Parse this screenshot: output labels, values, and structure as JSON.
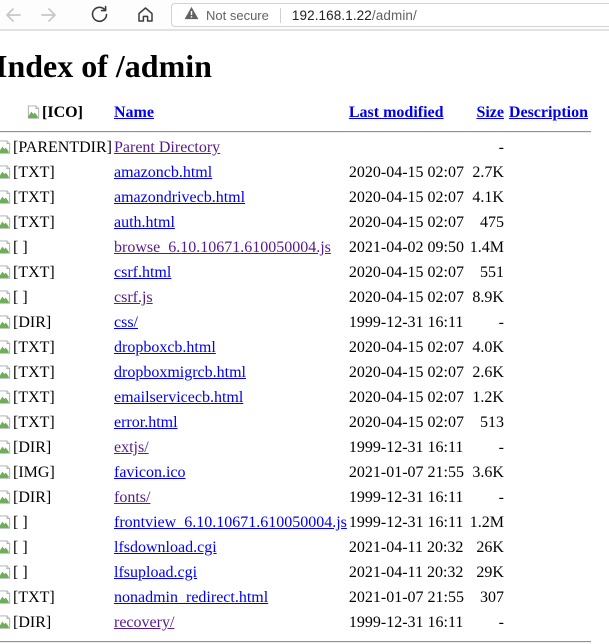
{
  "browser": {
    "security_label": "Not secure",
    "url_host": "192.168.1.22",
    "url_path": "/admin/"
  },
  "page": {
    "title": "Index of /admin",
    "columns": {
      "icon_alt": "[ICO]",
      "name": "Name",
      "last_modified": "Last modified",
      "size": "Size",
      "description": "Description"
    },
    "rows": [
      {
        "icon_alt": "[PARENTDIR]",
        "name": "Parent Directory",
        "last_modified": "",
        "size": "-",
        "description": "",
        "visited": true
      },
      {
        "icon_alt": "[TXT]",
        "name": "amazoncb.html",
        "last_modified": "2020-04-15 02:07",
        "size": "2.7K",
        "description": "",
        "visited": false
      },
      {
        "icon_alt": "[TXT]",
        "name": "amazondrivecb.html",
        "last_modified": "2020-04-15 02:07",
        "size": "4.1K",
        "description": "",
        "visited": false
      },
      {
        "icon_alt": "[TXT]",
        "name": "auth.html",
        "last_modified": "2020-04-15 02:07",
        "size": "475",
        "description": "",
        "visited": false
      },
      {
        "icon_alt": "[ ]",
        "name": "browse_6.10.10671.610050004.js",
        "last_modified": "2021-04-02 09:50",
        "size": "1.4M",
        "description": "",
        "visited": true
      },
      {
        "icon_alt": "[TXT]",
        "name": "csrf.html",
        "last_modified": "2020-04-15 02:07",
        "size": "551",
        "description": "",
        "visited": false
      },
      {
        "icon_alt": "[ ]",
        "name": "csrf.js",
        "last_modified": "2020-04-15 02:07",
        "size": "8.9K",
        "description": "",
        "visited": true
      },
      {
        "icon_alt": "[DIR]",
        "name": "css/",
        "last_modified": "1999-12-31 16:11",
        "size": "-",
        "description": "",
        "visited": false
      },
      {
        "icon_alt": "[TXT]",
        "name": "dropboxcb.html",
        "last_modified": "2020-04-15 02:07",
        "size": "4.0K",
        "description": "",
        "visited": false
      },
      {
        "icon_alt": "[TXT]",
        "name": "dropboxmigrcb.html",
        "last_modified": "2020-04-15 02:07",
        "size": "2.6K",
        "description": "",
        "visited": false
      },
      {
        "icon_alt": "[TXT]",
        "name": "emailservicecb.html",
        "last_modified": "2020-04-15 02:07",
        "size": "1.2K",
        "description": "",
        "visited": false
      },
      {
        "icon_alt": "[TXT]",
        "name": "error.html",
        "last_modified": "2020-04-15 02:07",
        "size": "513",
        "description": "",
        "visited": false
      },
      {
        "icon_alt": "[DIR]",
        "name": "extjs/",
        "last_modified": "1999-12-31 16:11",
        "size": "-",
        "description": "",
        "visited": true
      },
      {
        "icon_alt": "[IMG]",
        "name": "favicon.ico",
        "last_modified": "2021-01-07 21:55",
        "size": "3.6K",
        "description": "",
        "visited": false
      },
      {
        "icon_alt": "[DIR]",
        "name": "fonts/",
        "last_modified": "1999-12-31 16:11",
        "size": "-",
        "description": "",
        "visited": true
      },
      {
        "icon_alt": "[ ]",
        "name": "frontview_6.10.10671.610050004.js",
        "last_modified": "1999-12-31 16:11",
        "size": "1.2M",
        "description": "",
        "visited": false
      },
      {
        "icon_alt": "[ ]",
        "name": "lfsdownload.cgi",
        "last_modified": "2021-04-11 20:32",
        "size": "26K",
        "description": "",
        "visited": false
      },
      {
        "icon_alt": "[ ]",
        "name": "lfsupload.cgi",
        "last_modified": "2021-04-11 20:32",
        "size": "29K",
        "description": "",
        "visited": false
      },
      {
        "icon_alt": "[TXT]",
        "name": "nonadmin_redirect.html",
        "last_modified": "2021-01-07 21:55",
        "size": "307",
        "description": "",
        "visited": false
      },
      {
        "icon_alt": "[DIR]",
        "name": "recovery/",
        "last_modified": "1999-12-31 16:11",
        "size": "-",
        "description": "",
        "visited": true
      }
    ]
  },
  "colors": {
    "link_blue": "#0000EE",
    "link_visited": "#551A8B",
    "toolbar_icon_disabled": "#c7c7c7",
    "toolbar_icon": "#3c3c3c",
    "secure_badge_gray": "#5f6368"
  }
}
